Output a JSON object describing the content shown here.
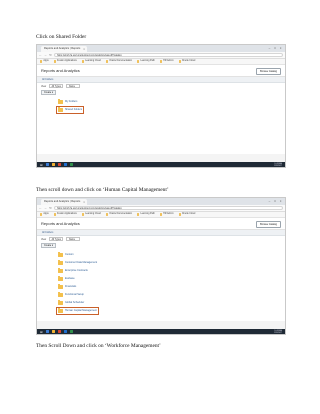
{
  "doc": {
    "step1": "Click on Shared Folder",
    "step2": "Then scroll down and click on ‘Human Capital Management’",
    "step3": "Then Scroll Down and click on ‘Workforce Management’"
  },
  "browser": {
    "tab_title": "Reports and Analytics | Reports",
    "tab_close": "×",
    "window_controls": "– □ ×",
    "back_icon": "←",
    "forward_icon": "→",
    "reload_icon": "↻",
    "url": "https://eboh.fa.us2.oraclecloud.com/analytics/saw.dll?catalog",
    "bookmarks": [
      {
        "label": "Apps"
      },
      {
        "label": "Fusion Applications"
      },
      {
        "label": "Learning Cloud"
      },
      {
        "label": "Oracle Documentation"
      },
      {
        "label": "Learning Path"
      },
      {
        "label": "HR Admin"
      },
      {
        "label": "Oracle Cloud"
      },
      {
        "label": "Oracle Guides"
      },
      {
        "label": "Other bookmarks"
      }
    ]
  },
  "app": {
    "title": "Reports and Analytics",
    "browse_button": "Browse Catalog",
    "breadcrumb": "All Folders",
    "view_label": "View",
    "view_select_1": "All Types",
    "view_select_2": "Name",
    "create_button": "Create ▾"
  },
  "shot1": {
    "folders": [
      {
        "name": "My Folders"
      },
      {
        "name": "Shared Folders"
      }
    ]
  },
  "shot2": {
    "folders": [
      {
        "name": "Custom"
      },
      {
        "name": "Customer Data Management"
      },
      {
        "name": "Enterprise Contracts"
      },
      {
        "name": "Essbase"
      },
      {
        "name": "Financials"
      },
      {
        "name": "Functional Setup"
      },
      {
        "name": "Global Scheduler"
      },
      {
        "name": "Human Capital Management"
      }
    ]
  },
  "taskbar": {
    "start_icon": "⊞",
    "time": "10:35 AM",
    "date": "1/20/2017"
  },
  "colors": {
    "folder": "#f3c04c",
    "highlight": "#c9602a",
    "link": "#2d5d94"
  }
}
